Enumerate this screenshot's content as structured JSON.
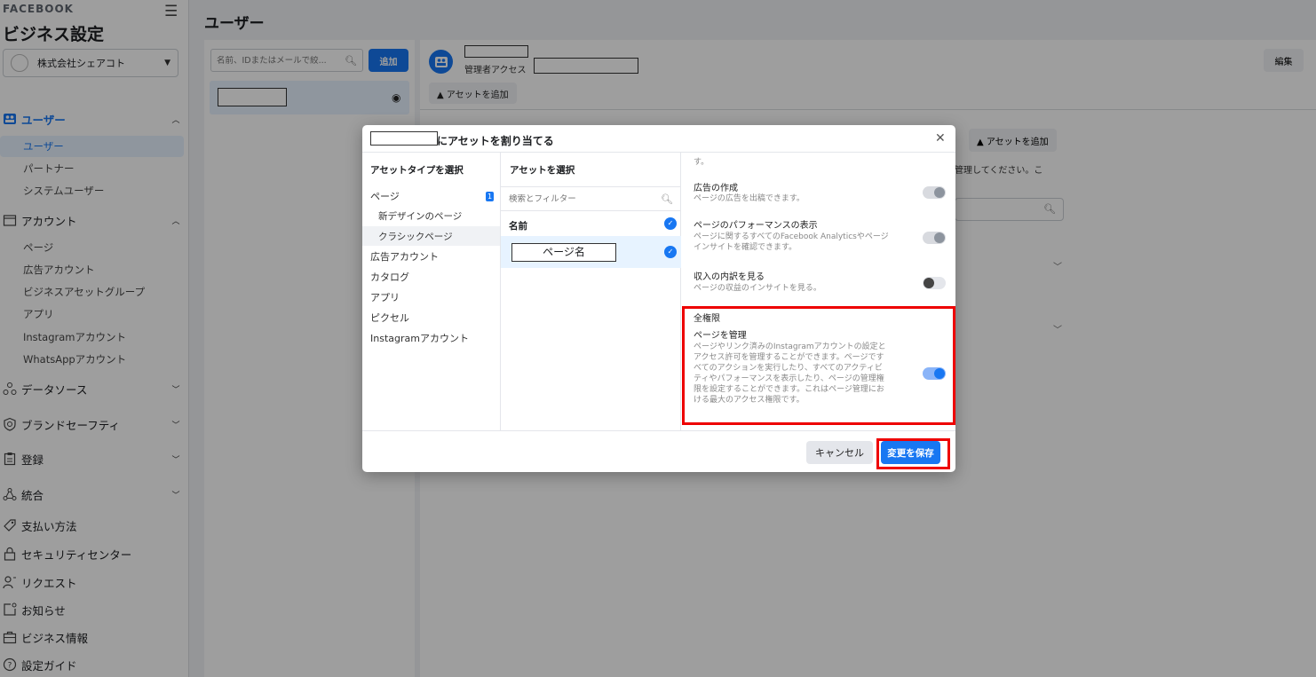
{
  "sidebar": {
    "brand_sub": "FACEBOOK",
    "brand_title": "ビジネス設定",
    "business_name": "株式会社シェアコト",
    "sections": {
      "users": {
        "label": "ユーザー",
        "items": [
          "ユーザー",
          "パートナー",
          "システムユーザー"
        ]
      },
      "accounts": {
        "label": "アカウント",
        "items": [
          "ページ",
          "広告アカウント",
          "ビジネスアセットグループ",
          "アプリ",
          "Instagramアカウント",
          "WhatsAppアカウント"
        ]
      },
      "data_sources": "データソース",
      "brand_safety": "ブランドセーフティ",
      "registration": "登録",
      "integration": "統合",
      "payment": "支払い方法",
      "security": "セキュリティセンター",
      "requests": "リクエスト",
      "notifications": "お知らせ",
      "business_info": "ビジネス情報",
      "setup_guide": "設定ガイド"
    }
  },
  "main": {
    "page_title": "ユーザー",
    "search_placeholder": "名前、IDまたはメールで絞...",
    "add_button": "追加",
    "detail": {
      "access_label": "管理者アクセス",
      "add_asset": "アセットを追加",
      "edit": "編集",
      "assets_add": "アセットを追加",
      "desc_fragment": "・管理してください。こ"
    }
  },
  "modal": {
    "title_suffix": "にアセットを割り当てる",
    "col1_header": "アセットタイプを選択",
    "col1_badge": "1",
    "asset_types": [
      "ページ",
      "新デザインのページ",
      "クラシックページ",
      "広告アカウント",
      "カタログ",
      "アプリ",
      "ピクセル",
      "Instagramアカウント"
    ],
    "col2_header": "アセットを選択",
    "col2_search_placeholder": "検索とフィルター",
    "col2_name_header": "名前",
    "selected_asset": "ページ名",
    "permissions": {
      "lead_text": "す。",
      "create_ads_title": "広告の作成",
      "create_ads_desc": "ページの広告を出稿できます。",
      "perf_title": "ページのパフォーマンスの表示",
      "perf_desc_1": "ページに関するすべてのFacebook Analyticsやページ",
      "perf_desc_2": "インサイトを確認できます。",
      "revenue_title": "収入の内訳を見る",
      "revenue_desc": "ページの収益のインサイトを見る。",
      "full_header": "全権限",
      "manage_title": "ページを管理",
      "manage_desc_1": "ページやリンク済みのInstagramアカウントの設定と",
      "manage_desc_2": "アクセス許可を管理することができます。ページです",
      "manage_desc_3": "べてのアクションを実行したり、すべてのアクティビ",
      "manage_desc_4": "ティやパフォーマンスを表示したり、ページの管理権",
      "manage_desc_5": "限を設定することができます。これはページ管理にお",
      "manage_desc_6": "ける最大のアクセス権限です。"
    },
    "cancel": "キャンセル",
    "save": "変更を保存"
  },
  "colors": {
    "primary": "#1877f2",
    "highlight": "#ee0000"
  }
}
